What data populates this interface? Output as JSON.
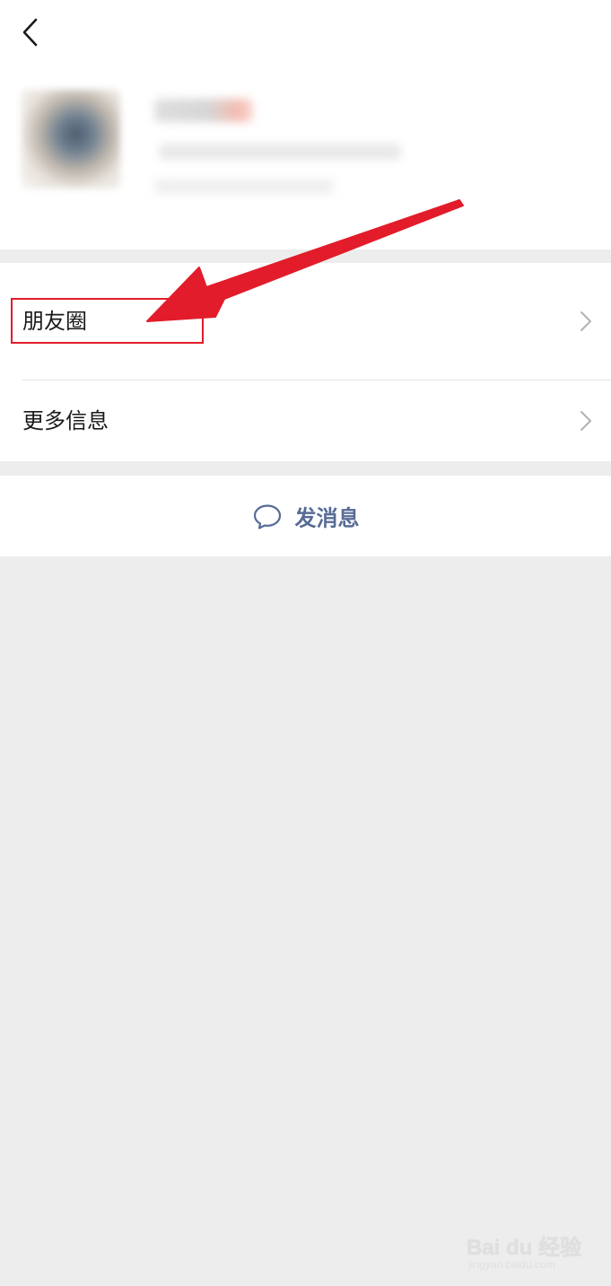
{
  "header": {
    "back_icon": "chevron-left-icon"
  },
  "menu": {
    "items": [
      {
        "label": "朋友圈",
        "icon": "chevron-right-icon"
      },
      {
        "label": "更多信息",
        "icon": "chevron-right-icon"
      }
    ]
  },
  "actions": {
    "send_message_label": "发消息",
    "send_message_icon": "chat-bubble-icon",
    "accent_color": "#576b95"
  },
  "annotation": {
    "color": "#e21c2a"
  },
  "watermark": {
    "brand": "Bai du 经验",
    "url": "jingyan.baidu.com"
  }
}
